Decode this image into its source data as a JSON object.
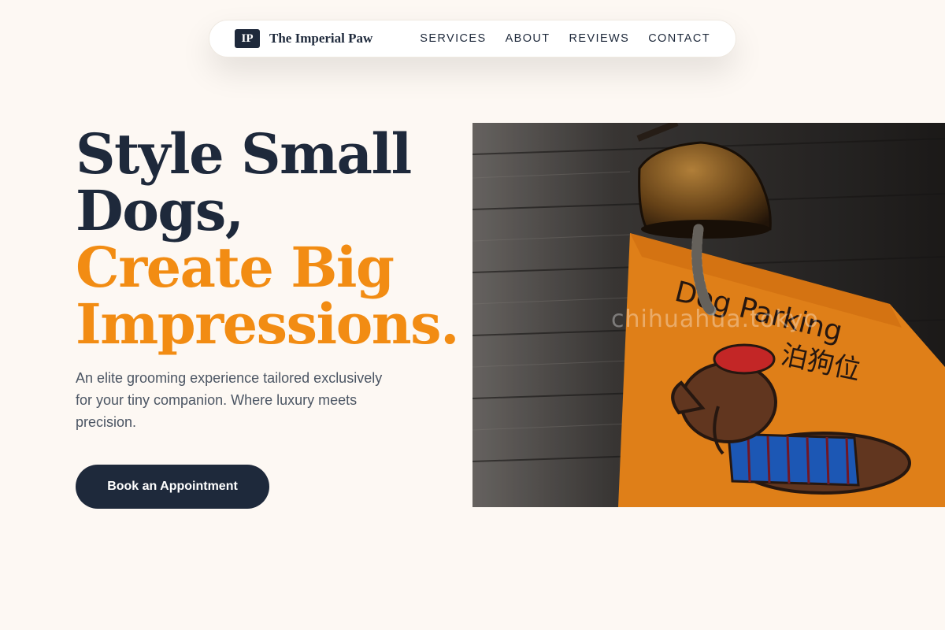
{
  "nav": {
    "logo_mark": "IP",
    "brand": "The Imperial Paw",
    "links": [
      "SERVICES",
      "ABOUT",
      "REVIEWS",
      "CONTACT"
    ]
  },
  "hero": {
    "headline_dark": [
      "Style Small",
      "Dogs,"
    ],
    "headline_accent": [
      "Create Big",
      "Impressions."
    ],
    "subtitle": "An elite grooming experience tailored exclusively for your tiny companion. Where luxury meets precision.",
    "cta_label": "Book an Appointment"
  },
  "photo": {
    "sign_text": "Dog Parking",
    "sign_text_cjk": "泊狗位",
    "watermark": "chihuahua.tokyo"
  },
  "colors": {
    "background": "#fdf8f3",
    "navy": "#1e293b",
    "accent_orange": "#f28c13",
    "body_text": "#4b5563"
  }
}
